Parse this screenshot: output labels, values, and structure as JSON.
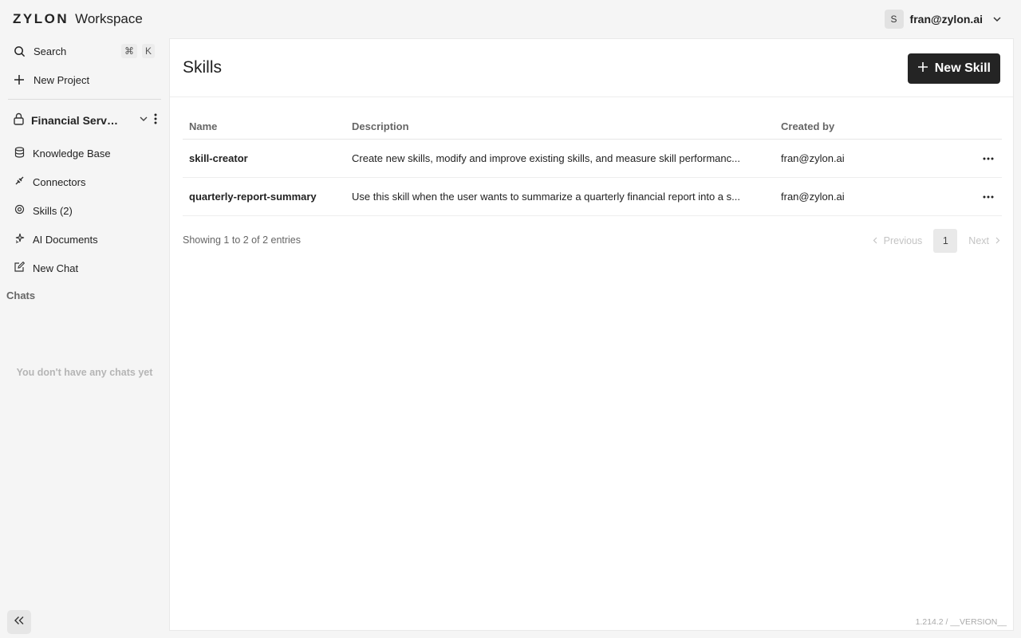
{
  "brand": {
    "logo": "ZYLON",
    "suffix": "Workspace"
  },
  "user": {
    "initial": "S",
    "email": "fran@zylon.ai"
  },
  "sidebar": {
    "search_label": "Search",
    "search_shortcut": [
      "⌘",
      "K"
    ],
    "new_project_label": "New Project",
    "project_name": "Financial Servic...",
    "nav": [
      {
        "label": "Knowledge Base",
        "icon": "database-icon"
      },
      {
        "label": "Connectors",
        "icon": "plug-icon"
      },
      {
        "label": "Skills (2)",
        "icon": "skills-icon"
      },
      {
        "label": "AI Documents",
        "icon": "sparkles-icon"
      },
      {
        "label": "New Chat",
        "icon": "compose-icon"
      }
    ],
    "chats_label": "Chats",
    "empty_chats": "You don't have any chats yet"
  },
  "main": {
    "title": "Skills",
    "new_button_label": "New Skill",
    "table": {
      "headers": [
        "Name",
        "Description",
        "Created by"
      ],
      "rows": [
        {
          "name": "skill-creator",
          "description": "Create new skills, modify and improve existing skills, and measure skill performanc...",
          "created_by": "fran@zylon.ai"
        },
        {
          "name": "quarterly-report-summary",
          "description": "Use this skill when the user wants to summarize a quarterly financial report into a s...",
          "created_by": "fran@zylon.ai"
        }
      ]
    },
    "entries_text": "Showing 1 to 2 of 2 entries",
    "pagination": {
      "previous": "Previous",
      "current": "1",
      "next": "Next"
    }
  },
  "version": "1.214.2 / __VERSION__"
}
